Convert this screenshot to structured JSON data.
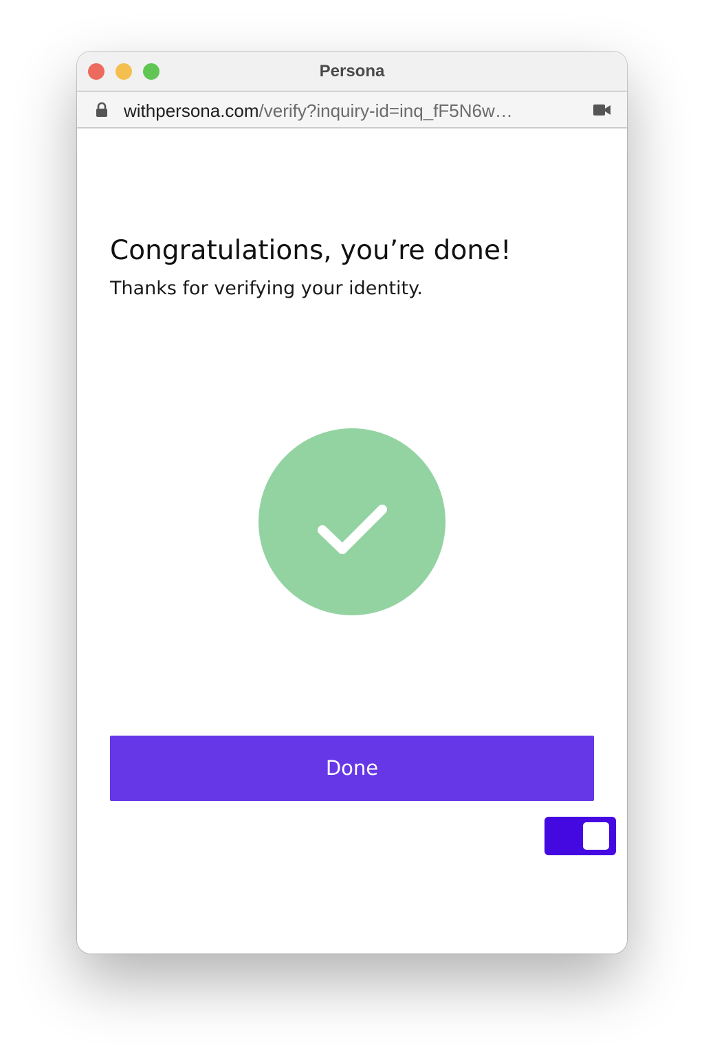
{
  "window": {
    "title": "Persona"
  },
  "address_bar": {
    "host": "withpersona.com",
    "path": "/verify?inquiry-id=inq_fF5N6w…"
  },
  "icons": {
    "lock": "lock-icon",
    "camera": "video-camera-icon",
    "check": "checkmark-icon"
  },
  "main": {
    "heading": "Congratulations, you’re done!",
    "subheading": "Thanks for verifying your identity.",
    "done_button_label": "Done",
    "toggle_state": "on"
  },
  "colors": {
    "close": "#ec6a5e",
    "minimize": "#f4bf4f",
    "zoom": "#61c554",
    "success_circle": "#93d3a2",
    "button": "#6637e6",
    "toggle": "#4409e1"
  }
}
